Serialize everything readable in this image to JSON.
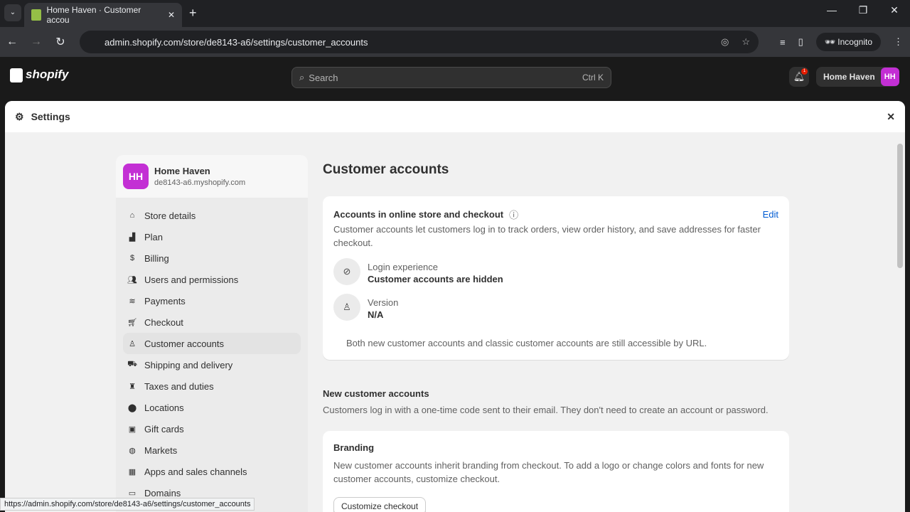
{
  "browser": {
    "tab_title": "Home Haven · Customer accou",
    "url": "admin.shopify.com/store/de8143-a6/settings/customer_accounts",
    "incognito": "Incognito",
    "status_url": "https://admin.shopify.com/store/de8143-a6/settings/customer_accounts"
  },
  "topbar": {
    "logo": "shopify",
    "search_placeholder": "Search",
    "shortcut": "Ctrl K",
    "notif_count": "1",
    "store": "Home Haven",
    "avatar": "HH"
  },
  "settings": {
    "title": "Settings"
  },
  "sidebar": {
    "store_name": "Home Haven",
    "domain": "de8143-a6.myshopify.com",
    "avatar": "HH",
    "items": [
      {
        "label": "Store details",
        "icon": "store-icon"
      },
      {
        "label": "Plan",
        "icon": "plan-icon"
      },
      {
        "label": "Billing",
        "icon": "billing-icon"
      },
      {
        "label": "Users and permissions",
        "icon": "users-icon"
      },
      {
        "label": "Payments",
        "icon": "payments-icon"
      },
      {
        "label": "Checkout",
        "icon": "cart-icon"
      },
      {
        "label": "Customer accounts",
        "icon": "person-icon",
        "active": true
      },
      {
        "label": "Shipping and delivery",
        "icon": "truck-icon"
      },
      {
        "label": "Taxes and duties",
        "icon": "tax-icon"
      },
      {
        "label": "Locations",
        "icon": "location-icon"
      },
      {
        "label": "Gift cards",
        "icon": "gift-icon"
      },
      {
        "label": "Markets",
        "icon": "globe-icon"
      },
      {
        "label": "Apps and sales channels",
        "icon": "apps-icon"
      },
      {
        "label": "Domains",
        "icon": "domain-icon"
      }
    ]
  },
  "main": {
    "title": "Customer accounts",
    "card1": {
      "title": "Accounts in online store and checkout",
      "edit": "Edit",
      "desc": "Customer accounts let customers log in to track orders, view order history, and save addresses for faster checkout.",
      "login_label": "Login experience",
      "login_value": "Customer accounts are hidden",
      "version_label": "Version",
      "version_value": "N/A",
      "note": "Both new customer accounts and classic customer accounts are still accessible by URL."
    },
    "section2": {
      "title": "New customer accounts",
      "desc": "Customers log in with a one-time code sent to their email. They don't need to create an account or password."
    },
    "card2": {
      "title": "Branding",
      "desc": "New customer accounts inherit branding from checkout. To add a logo or change colors and fonts for new customer accounts, customize checkout.",
      "button": "Customize checkout"
    }
  }
}
